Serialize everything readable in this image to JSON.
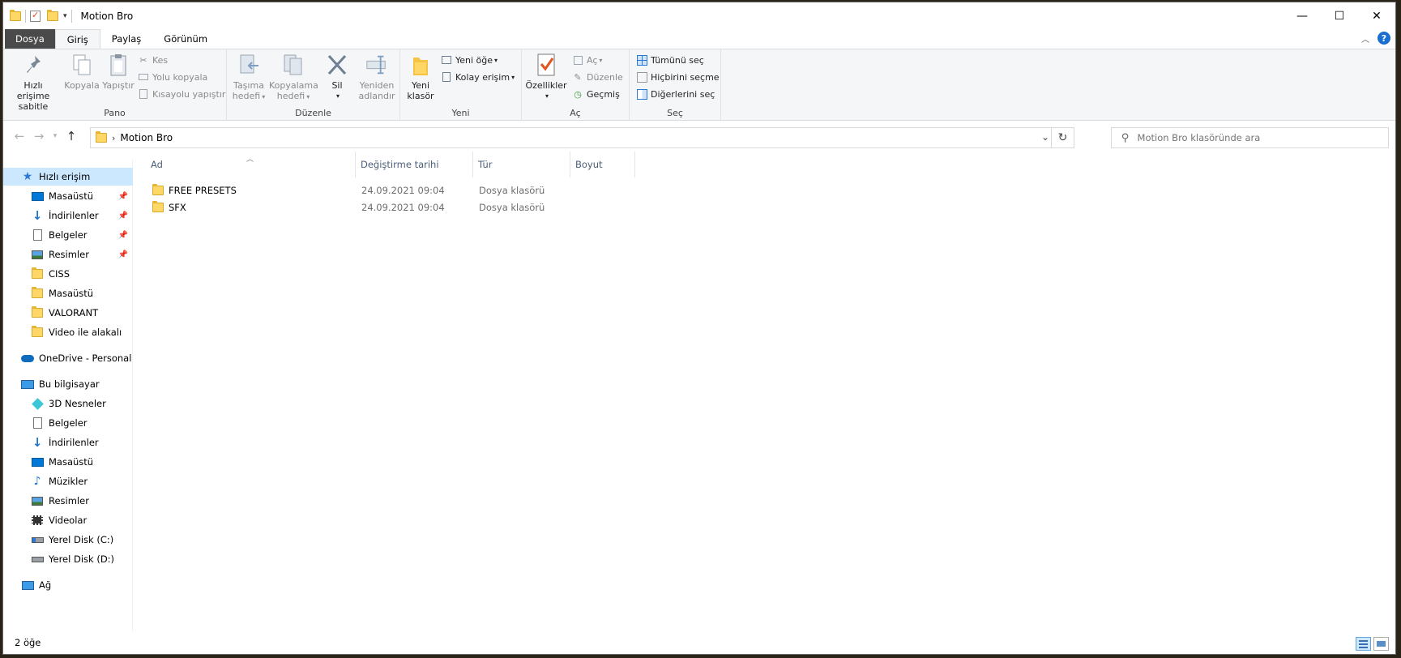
{
  "window": {
    "title": "Motion Bro"
  },
  "window_controls": {
    "minimize": "—",
    "maximize": "☐",
    "close": "✕"
  },
  "ribbon_tabs": [
    "Dosya",
    "Giriş",
    "Paylaş",
    "Görünüm"
  ],
  "ribbon": {
    "pano": {
      "label": "Pano",
      "pin": "Hızlı erişime sabitle",
      "pin_line1": "Hızlı erişime",
      "pin_line2": "sabitle",
      "copy": "Kopyala",
      "paste": "Yapıştır",
      "cut": "Kes",
      "copy_path": "Yolu kopyala",
      "paste_shortcut": "Kısayolu yapıştır"
    },
    "duzenle": {
      "label": "Düzenle",
      "move_line1": "Taşıma",
      "move_line2": "hedefi",
      "copyto_line1": "Kopyalama",
      "copyto_line2": "hedefi",
      "delete": "Sil",
      "rename_line1": "Yeniden",
      "rename_line2": "adlandır"
    },
    "yeni": {
      "label": "Yeni",
      "new_folder_line1": "Yeni",
      "new_folder_line2": "klasör",
      "new_item": "Yeni öğe",
      "easy_access": "Kolay erişim"
    },
    "ac": {
      "label": "Aç",
      "properties": "Özellikler",
      "open": "Aç",
      "edit": "Düzenle",
      "history": "Geçmiş"
    },
    "sec": {
      "label": "Seç",
      "select_all": "Tümünü seç",
      "select_none": "Hiçbirini seçme",
      "invert": "Diğerlerini seç"
    }
  },
  "address": {
    "path": "Motion Bro"
  },
  "search": {
    "placeholder": "Motion Bro klasöründe ara"
  },
  "nav": {
    "quick_access": "Hızlı erişim",
    "quick_items": [
      "Masaüstü",
      "İndirilenler",
      "Belgeler",
      "Resimler",
      "CISS",
      "Masaüstü",
      "VALORANT",
      "Video ile alakalı"
    ],
    "onedrive": "OneDrive - Personal",
    "this_pc": "Bu bilgisayar",
    "pc_items": [
      "3D Nesneler",
      "Belgeler",
      "İndirilenler",
      "Masaüstü",
      "Müzikler",
      "Resimler",
      "Videolar",
      "Yerel Disk (C:)",
      "Yerel Disk (D:)"
    ],
    "network": "Ağ"
  },
  "columns": {
    "name": "Ad",
    "date": "Değiştirme tarihi",
    "type": "Tür",
    "size": "Boyut"
  },
  "files": [
    {
      "name": "FREE PRESETS",
      "date": "24.09.2021 09:04",
      "type": "Dosya klasörü",
      "size": ""
    },
    {
      "name": "SFX",
      "date": "24.09.2021 09:04",
      "type": "Dosya klasörü",
      "size": ""
    }
  ],
  "status": {
    "count": "2 öğe"
  }
}
